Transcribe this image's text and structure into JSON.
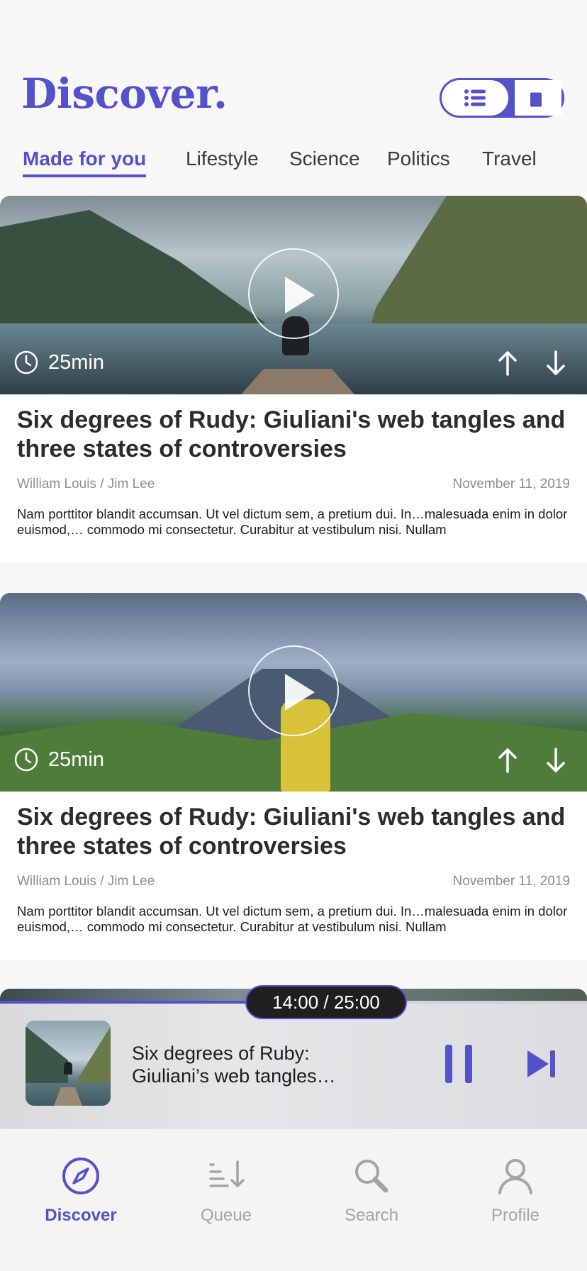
{
  "header": {
    "brand": "Discover.",
    "view_toggle": {
      "options": [
        "list-icon",
        "cards-icon"
      ],
      "selected": "list"
    }
  },
  "tabs": [
    {
      "label": "Made for you",
      "active": true
    },
    {
      "label": "Lifestyle",
      "active": false
    },
    {
      "label": "Science",
      "active": false
    },
    {
      "label": "Politics",
      "active": false
    },
    {
      "label": "Travel",
      "active": false
    }
  ],
  "articles": [
    {
      "duration": "25min",
      "title": "Six degrees of Rudy: Giuliani's web tangles and three states of controversies",
      "authors": "William Louis / Jim Lee",
      "date": "November 11, 2019",
      "excerpt": "Nam porttitor blandit accumsan. Ut vel dictum sem, a pretium dui. In…malesuada enim in dolor euismod,… commodo mi consectetur. Curabitur at vestibulum nisi. Nullam"
    },
    {
      "duration": "25min",
      "title": "Six degrees of Rudy: Giuliani's web tangles and three states of controversies",
      "authors": "William Louis / Jim Lee",
      "date": "November 11, 2019",
      "excerpt": "Nam porttitor blandit accumsan. Ut vel dictum sem, a pretium dui. In…malesuada enim in dolor euismod,… commodo mi consectetur. Curabitur at vestibulum nisi. Nullam"
    }
  ],
  "player": {
    "time": "14:00 / 25:00",
    "progress": 0.56,
    "title": "Six degrees of Ruby: Giuliani’s web tangles…"
  },
  "nav": [
    {
      "label": "Discover",
      "icon": "compass-icon",
      "active": true
    },
    {
      "label": "Queue",
      "icon": "queue-icon",
      "active": false
    },
    {
      "label": "Search",
      "icon": "search-icon",
      "active": false
    },
    {
      "label": "Profile",
      "icon": "profile-icon",
      "active": false
    }
  ],
  "colors": {
    "accent": "#5451cc",
    "inactive": "#a4a4a8",
    "text": "#2c2c2e"
  }
}
